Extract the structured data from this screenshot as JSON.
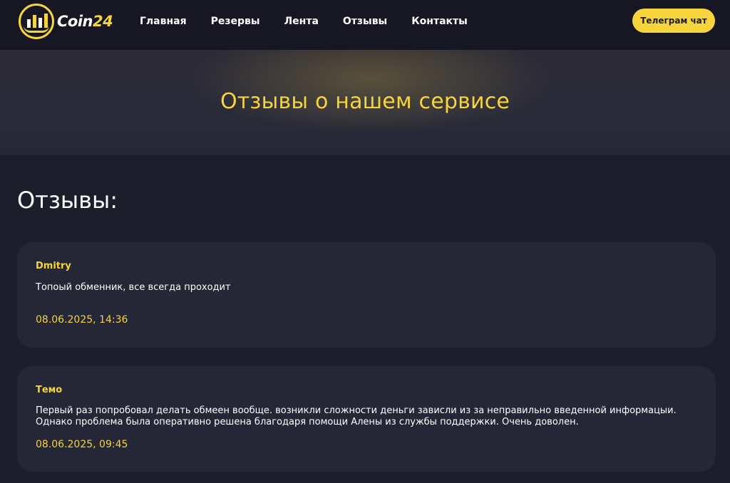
{
  "brand": {
    "logo_part1": "Coin",
    "logo_part2": "24"
  },
  "nav": {
    "items": [
      {
        "label": "Главная"
      },
      {
        "label": "Резервы"
      },
      {
        "label": "Лента"
      },
      {
        "label": "Отзывы"
      },
      {
        "label": "Контакты"
      }
    ]
  },
  "header": {
    "telegram_button": "Телеграм чат"
  },
  "hero": {
    "title": "Отзывы о нашем сервисе"
  },
  "main": {
    "section_title": "Отзывы:",
    "reviews": [
      {
        "author": "Dmitry",
        "text": "Топоый обменник, все всегда проходит",
        "date": "08.06.2025, 14:36"
      },
      {
        "author": "Темо",
        "text": "Первый раз попробовал делать обмеен вообще. возникли сложности деньги зависли из за неправильно введенной информацыи. Однако проблема была оперативно решена благодаря помощи Алены из службы поддержки. Очень доволен.",
        "date": "08.06.2025, 09:45"
      }
    ]
  },
  "colors": {
    "accent": "#f5d43c",
    "background": "#1d1e2b",
    "card": "#262736",
    "header": "#161722"
  }
}
